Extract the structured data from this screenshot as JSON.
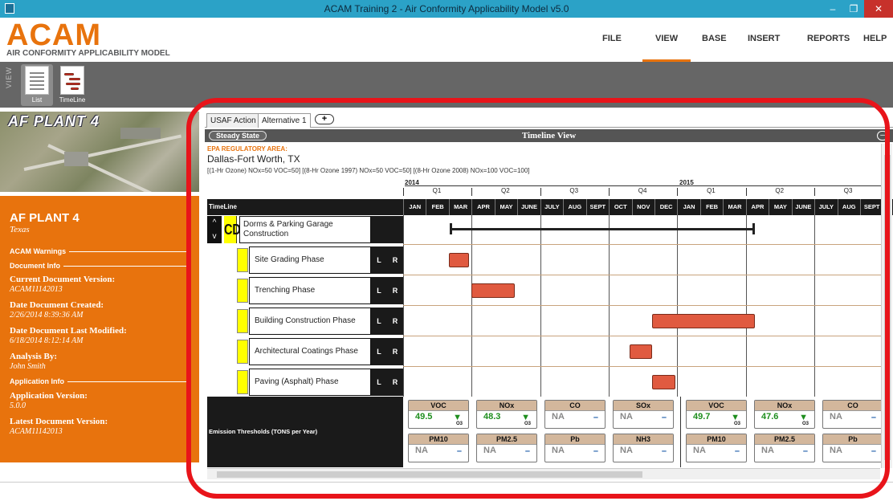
{
  "window": {
    "title": "ACAM Training 2 - Air Conformity Applicability Model v5.0",
    "min": "–",
    "max": "❐",
    "close": "✕"
  },
  "header": {
    "logo": "ACAM",
    "logo_sub": "AIR CONFORMITY APPLICABILITY MODEL",
    "menu": [
      "FILE",
      "VIEW",
      "BASE",
      "INSERT",
      "REPORTS",
      "HELP"
    ],
    "active_menu": "VIEW"
  },
  "toolbar": {
    "section_label": "VIEW",
    "buttons": [
      {
        "label": "List",
        "icon": "list-document-icon"
      },
      {
        "label": "TimeLine",
        "icon": "timeline-document-icon"
      }
    ]
  },
  "left": {
    "image_title": "AF PLANT 4",
    "plant_name": "AF PLANT 4",
    "state": "Texas",
    "warnings_label": "ACAM Warnings",
    "document_info_label": "Document Info",
    "current_version_label": "Current Document Version:",
    "current_version_value": "ACAM11142013",
    "created_label": "Date Document Created:",
    "created_value": "2/26/2014 8:39:36 AM",
    "modified_label": "Date Document Last Modified:",
    "modified_value": "6/18/2014 8:12:14 AM",
    "analysis_label": "Analysis By:",
    "analysis_value": "John Smith",
    "app_info_label": "Application Info",
    "app_version_label": "Application Version:",
    "app_version_value": "5.0.0",
    "latest_version_label": "Latest Document Version:",
    "latest_version_value": "ACAM11142013"
  },
  "main": {
    "tabs": [
      "USAF Action",
      "Alternative 1"
    ],
    "active_tab": "Alternative 1",
    "add_tab": "+",
    "steady_state": "Steady State",
    "view_title": "Timeline View",
    "collapse": "–",
    "epa_label": "EPA REGULATORY AREA:",
    "epa_place": "Dallas-Fort Worth, TX",
    "epa_detail": "[(1-Hr Ozone) NOx=50 VOC=50]  [(8-Hr Ozone 1997) NOx=50 VOC=50]  [(8-Hr Ozone 2008) NOx=100 VOC=100]",
    "timeline_label": "TimeLine",
    "years": [
      "2014",
      "2015"
    ],
    "quarters": [
      "Q1",
      "Q2",
      "Q3",
      "Q4",
      "Q1",
      "Q2",
      "Q3"
    ],
    "months": [
      "JAN",
      "FEB",
      "MAR",
      "APR",
      "MAY",
      "JUNE",
      "JULY",
      "AUG",
      "SEPT",
      "OCT",
      "NOV",
      "DEC",
      "JAN",
      "FEB",
      "MAR",
      "APR",
      "MAY",
      "JUNE",
      "JULY",
      "AUG",
      "SEPT"
    ],
    "project": {
      "up": "^",
      "down": "v",
      "badge": "CD",
      "name": "Dorms & Parking Garage Construction",
      "start_month_index": 2,
      "end_month_index": 15.3
    },
    "phases": [
      {
        "name": "Site Grading Phase",
        "L": "L",
        "R": "R",
        "start": 2.0,
        "end": 2.9
      },
      {
        "name": "Trenching Phase",
        "L": "L",
        "R": "R",
        "start": 3.0,
        "end": 4.9
      },
      {
        "name": "Building Construction Phase",
        "L": "L",
        "R": "R",
        "start": 10.9,
        "end": 15.4
      },
      {
        "name": "Architectural Coatings Phase",
        "L": "L",
        "R": "R",
        "start": 9.9,
        "end": 10.9
      },
      {
        "name": "Paving (Asphalt) Phase",
        "L": "L",
        "R": "R",
        "start": 10.9,
        "end": 11.9
      }
    ],
    "emissions_label": "Emission Thresholds (TONS per Year)",
    "emissions_2014_row1": [
      {
        "h": "VOC",
        "v": "49.5",
        "ind": "▼",
        "o3": "O3",
        "status": "green"
      },
      {
        "h": "NOx",
        "v": "48.3",
        "ind": "▼",
        "o3": "O3",
        "status": "green"
      },
      {
        "h": "CO",
        "v": "NA",
        "ind": "–",
        "o3": "",
        "status": "na"
      },
      {
        "h": "SOx",
        "v": "NA",
        "ind": "–",
        "o3": "",
        "status": "na"
      }
    ],
    "emissions_2014_row2": [
      {
        "h": "PM10",
        "v": "NA",
        "ind": "–",
        "o3": "",
        "status": "na"
      },
      {
        "h": "PM2.5",
        "v": "NA",
        "ind": "–",
        "o3": "",
        "status": "na"
      },
      {
        "h": "Pb",
        "v": "NA",
        "ind": "–",
        "o3": "",
        "status": "na"
      },
      {
        "h": "NH3",
        "v": "NA",
        "ind": "–",
        "o3": "",
        "status": "na"
      }
    ],
    "emissions_2015_row1": [
      {
        "h": "VOC",
        "v": "49.7",
        "ind": "▼",
        "o3": "O3",
        "status": "green"
      },
      {
        "h": "NOx",
        "v": "47.6",
        "ind": "▼",
        "o3": "O3",
        "status": "green"
      },
      {
        "h": "CO",
        "v": "NA",
        "ind": "–",
        "o3": "",
        "status": "na"
      }
    ],
    "emissions_2015_row2": [
      {
        "h": "PM10",
        "v": "NA",
        "ind": "–",
        "o3": "",
        "status": "na"
      },
      {
        "h": "PM2.5",
        "v": "NA",
        "ind": "–",
        "o3": "",
        "status": "na"
      },
      {
        "h": "Pb",
        "v": "NA",
        "ind": "–",
        "o3": "",
        "status": "na"
      }
    ]
  },
  "colors": {
    "accent": "#e8730d",
    "titlebar": "#2ba2c7",
    "bar": "#e05a40",
    "highlight": "#e8141a",
    "green": "#1e8e1e"
  }
}
